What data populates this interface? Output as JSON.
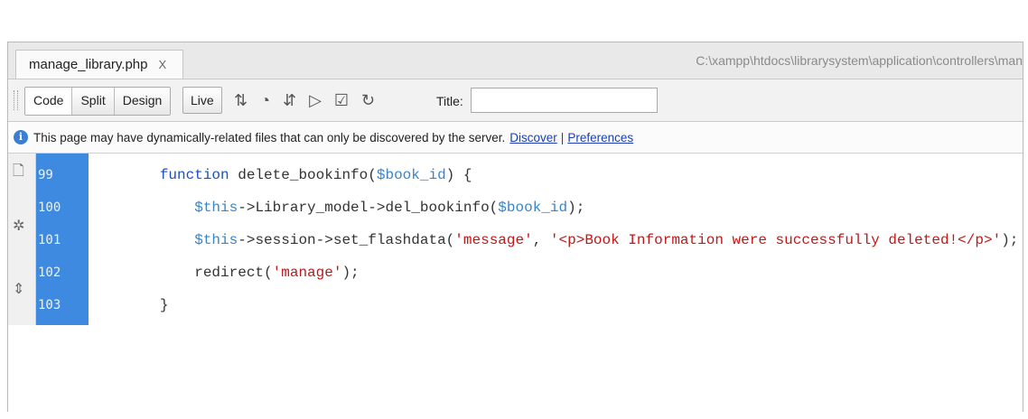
{
  "tab": {
    "filename": "manage_library.php",
    "close": "X"
  },
  "path": "C:\\xampp\\htdocs\\librarysystem\\application\\controllers\\man",
  "toolbar": {
    "views": [
      "Code",
      "Split",
      "Design"
    ],
    "live": "Live",
    "title_label": "Title:",
    "title_value": "",
    "icons": [
      "file-management-icon",
      "preview-browser-icon",
      "debug-icon",
      "visual-aids-icon",
      "validate-icon",
      "refresh-icon"
    ]
  },
  "infobar": {
    "icon": "i",
    "message": "This page may have dynamically-related files that can only be discovered by the server.",
    "link1": "Discover",
    "sep": "|",
    "link2": "Preferences"
  },
  "code": {
    "line_numbers": [
      "99",
      "100",
      "101",
      "102",
      "103"
    ],
    "l99": {
      "kw": "function",
      "name": " delete_bookinfo(",
      "var": "$book_id",
      "end": ") {"
    },
    "l100": {
      "var1": "$this",
      "mid": "->Library_model->del_bookinfo(",
      "var2": "$book_id",
      "end": ");"
    },
    "l101": {
      "var1": "$this",
      "mid": "->session->set_flashdata(",
      "str1": "'message'",
      "comma": ", ",
      "str2": "'<p>Book Information were successfully deleted!</p>'",
      "end": ");"
    },
    "l102": {
      "fn": "redirect(",
      "str": "'manage'",
      "end": ");"
    },
    "l103": {
      "text": "}"
    }
  },
  "colors": {
    "gutter": "#3d8ae0",
    "keyword": "#1c4fbf",
    "variable": "#3b84c6",
    "string": "#c01818"
  }
}
